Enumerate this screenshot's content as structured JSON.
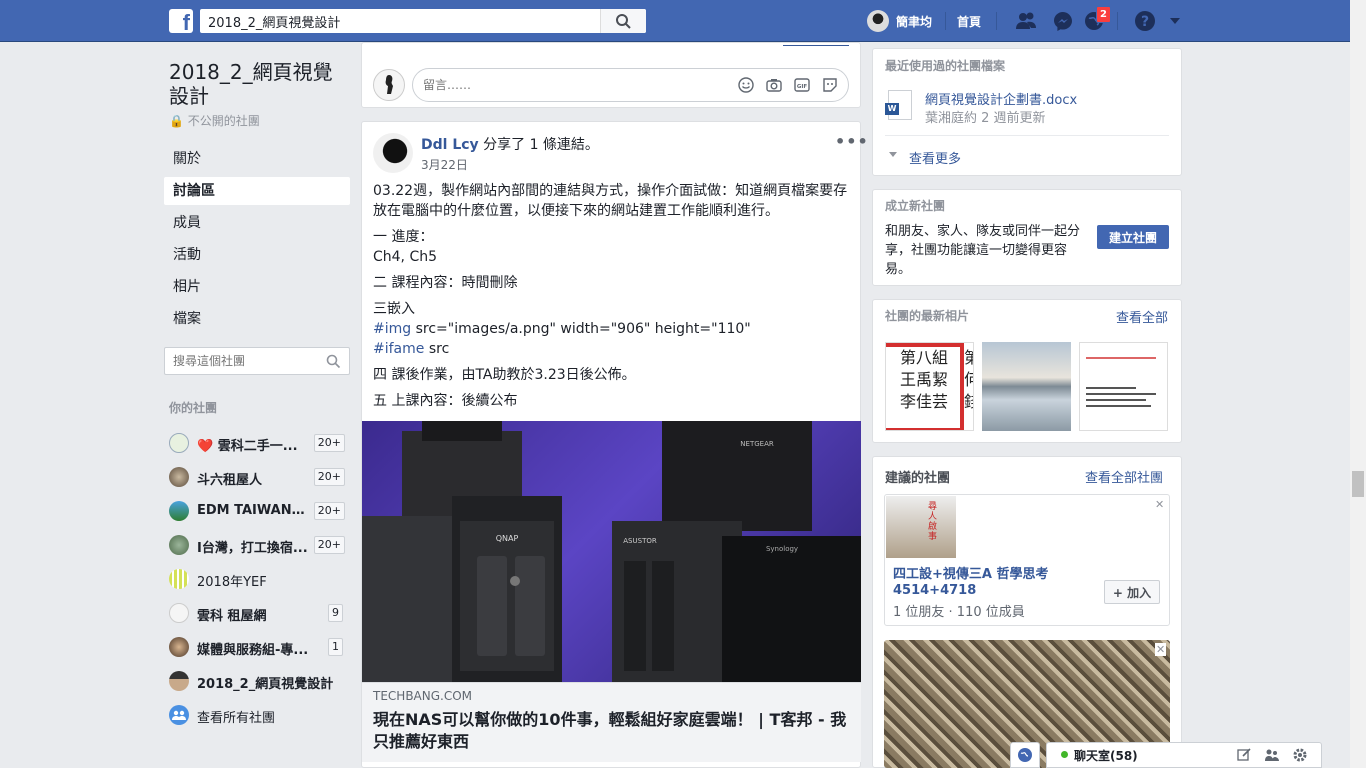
{
  "topbar": {
    "logo": "f",
    "search_value": "2018_2_網頁視覺設計",
    "user_name": "簡聿均",
    "home_label": "首頁",
    "notification_count": "2"
  },
  "left": {
    "group_title": "2018_2_網頁視覺設計",
    "privacy": "不公開的社團",
    "nav": [
      "關於",
      "討論區",
      "成員",
      "活動",
      "相片",
      "檔案"
    ],
    "search_placeholder": "搜尋這個社團",
    "your_groups_heading": "你的社團",
    "groups": [
      {
        "name": "❤️ 雲科二手一...",
        "count": "20+"
      },
      {
        "name": "斗六租屋人",
        "count": "20+"
      },
      {
        "name": "EDM TAIWAN (...",
        "count": "20+"
      },
      {
        "name": "I台灣，打工換宿...",
        "count": "20+"
      },
      {
        "name": "2018年YEF",
        "count": ""
      },
      {
        "name": "雲科 租屋網",
        "count": "9"
      },
      {
        "name": "媒體與服務組-專...",
        "count": "1"
      },
      {
        "name": "2018_2_網頁視覺設計",
        "count": ""
      },
      {
        "name": "查看所有社團",
        "count": ""
      }
    ]
  },
  "comment": {
    "placeholder": "留言……"
  },
  "post": {
    "author": "Ddl Lcy",
    "action": "分享了 1 條連結。",
    "date": "3月22日",
    "para1": "03.22週，製作網站內部間的連結與方式，操作介面試做：知道網頁檔案要存放在電腦中的什麼位置，以便接下來的網站建置工作能順利進行。",
    "progress_label": "一 進度：",
    "progress_value": "Ch4, Ch5",
    "course_content": "二 課程內容：時間刪除",
    "embed_label": "三嵌入",
    "hashtag_img": "#img",
    "img_code": " src=\"images/a.png\" width=\"906\" height=\"110\"",
    "hashtag_iframe": "#ifame",
    "iframe_code": " src",
    "homework": "四 課後作業，由TA助教於3.23日後公佈。",
    "next_class": "五 上課內容：後續公布",
    "link_domain": "TECHBANG.COM",
    "link_title": "現在NAS可以幫你做的10件事，輕鬆組好家庭雲端！ | T客邦 - 我只推薦好東西",
    "product_labels": [
      "QNAP",
      "NETGEAR",
      "Synology",
      "ASUSTOR"
    ]
  },
  "right": {
    "files_title": "最近使用過的社團檔案",
    "file_name": "網頁視覺設計企劃書.docx",
    "file_meta": "葉湘庭約 2 週前更新",
    "see_more": "查看更多",
    "create_title": "成立新社團",
    "create_desc": "和朋友、家人、隊友或同伴一起分享，社團功能讓這一切變得更容易。",
    "create_button": "建立社團",
    "photos_title": "社團的最新相片",
    "photos_seeall": "查看全部",
    "photo1_lines": [
      "第八組",
      "王禹絜",
      "李佳芸"
    ],
    "photo1_side": [
      "第",
      "何",
      "錢"
    ],
    "suggest_title": "建議的社團",
    "suggest_seeall": "查看全部社團",
    "suggest_name_line1": "四工設+視傳三A 哲學思考",
    "suggest_name_line2": "4514+4718",
    "suggest_meta": "1 位朋友 · 110 位成員",
    "join_button": "+ 加入",
    "suggest_img_text": "尋人啟事"
  },
  "chat": {
    "label": "聊天室(58)"
  },
  "colors": {
    "brand": "#4267b2",
    "link": "#365899",
    "badge": "#fa3e3e",
    "online": "#42b72a"
  }
}
